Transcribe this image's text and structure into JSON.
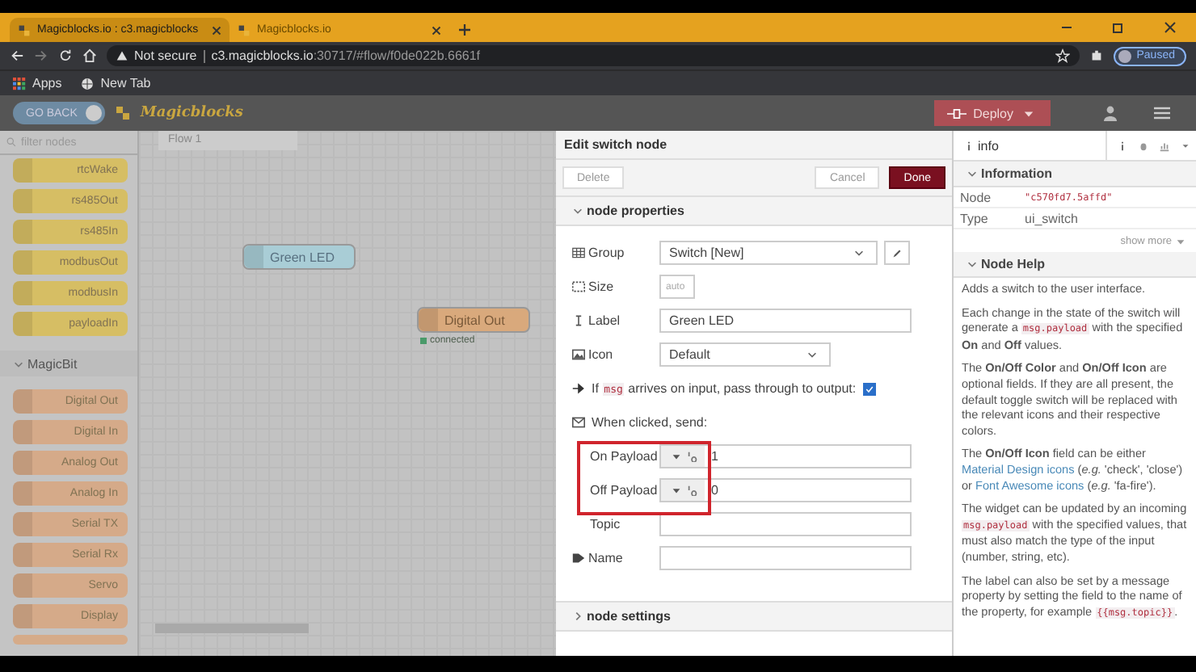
{
  "browser": {
    "tabs": [
      {
        "title": "Magicblocks.io : c3.magicblocks",
        "selected": true
      },
      {
        "title": "Magicblocks.io",
        "selected": false
      }
    ],
    "security": "Not secure",
    "url_host": "c3.magicblocks.io",
    "url_rest": ":30717/#flow/f0de022b.6661f",
    "profile": "Paused",
    "bookmarks": [
      "Apps",
      "New Tab"
    ]
  },
  "header": {
    "go_back": "GO BACK",
    "logo": "Magicblocks",
    "deploy": "Deploy"
  },
  "palette": {
    "placeholder": "filter nodes",
    "categories": [
      {
        "color": "#d9be5a",
        "nodes": [
          "rtcWake",
          "rs485Out",
          "rs485In",
          "modbusOut",
          "modbusIn",
          "payloadIn"
        ]
      },
      {
        "name": "MagicBit",
        "color": "#d7a883",
        "nodes": [
          "Digital Out",
          "Digital In",
          "Analog Out",
          "Analog In",
          "Serial TX",
          "Serial Rx",
          "Servo",
          "Display"
        ]
      }
    ]
  },
  "workspace": {
    "tab": "Flow 1",
    "nodes": [
      {
        "label": "Green LED",
        "color": "#a9cdd6"
      },
      {
        "label": "Digital Out",
        "color": "#d9a97c",
        "status": "connected"
      }
    ]
  },
  "tray": {
    "title": "Edit switch node",
    "buttons": {
      "delete": "Delete",
      "cancel": "Cancel",
      "done": "Done"
    },
    "sections": [
      {
        "title": "node properties",
        "expanded": true
      },
      {
        "title": "node settings",
        "expanded": false
      }
    ],
    "rows": [
      {
        "kind": "select",
        "label": "Group",
        "value": "Switch [New]"
      },
      {
        "kind": "size",
        "label": "Size",
        "value": "auto"
      },
      {
        "kind": "input",
        "label": "Label",
        "value": "Green LED"
      },
      {
        "kind": "select-short",
        "label": "Icon",
        "value": "Default"
      },
      {
        "kind": "checkbox",
        "before": "If",
        "code": "msg",
        "after": "arrives on input, pass through to output:",
        "checked": true
      },
      {
        "kind": "heading",
        "label": "When clicked, send:"
      },
      {
        "kind": "typed",
        "label": "On Payload",
        "value": "1"
      },
      {
        "kind": "typed",
        "label": "Off Payload",
        "value": "0"
      },
      {
        "kind": "input",
        "label": "Topic",
        "value": ""
      },
      {
        "kind": "input",
        "label": "Name",
        "value": ""
      }
    ]
  },
  "info": {
    "tab": "info",
    "sections": [
      "Information",
      "Node Help"
    ],
    "node_label": "Node",
    "node_value": "\"c570fd7.5affd\"",
    "type_label": "Type",
    "type_value": "ui_switch",
    "show_more": "show more",
    "help": [
      [
        {
          "kind": "text",
          "t": "Adds a switch to the user interface."
        }
      ],
      [
        {
          "kind": "text",
          "t": "Each change in the state of the switch will generate a "
        },
        {
          "kind": "code",
          "t": "msg.payload"
        },
        {
          "kind": "text",
          "t": " with the specified "
        },
        {
          "kind": "bold",
          "t": "On"
        },
        {
          "kind": "text",
          "t": " and "
        },
        {
          "kind": "bold",
          "t": "Off"
        },
        {
          "kind": "text",
          "t": " values."
        }
      ],
      [
        {
          "kind": "text",
          "t": "The "
        },
        {
          "kind": "bold",
          "t": "On/Off Color"
        },
        {
          "kind": "text",
          "t": " and "
        },
        {
          "kind": "bold",
          "t": "On/Off Icon"
        },
        {
          "kind": "text",
          "t": " are optional fields. If they are all present, the default toggle switch will be replaced with the relevant icons and their respective colors."
        }
      ],
      [
        {
          "kind": "text",
          "t": "The "
        },
        {
          "kind": "bold",
          "t": "On/Off Icon"
        },
        {
          "kind": "text",
          "t": " field can be either "
        },
        {
          "kind": "link",
          "t": "Material Design icons"
        },
        {
          "kind": "text",
          "t": " ("
        },
        {
          "kind": "italic",
          "t": "e.g."
        },
        {
          "kind": "text",
          "t": " 'check', 'close') or "
        },
        {
          "kind": "link",
          "t": "Font Awesome icons"
        },
        {
          "kind": "text",
          "t": " ("
        },
        {
          "kind": "italic",
          "t": "e.g."
        },
        {
          "kind": "text",
          "t": " 'fa-fire')."
        }
      ],
      [
        {
          "kind": "text",
          "t": "The widget can be updated by an incoming "
        },
        {
          "kind": "code",
          "t": "msg.payload"
        },
        {
          "kind": "text",
          "t": " with the specified values, that must also match the type of the input (number, string, etc)."
        }
      ],
      [
        {
          "kind": "text",
          "t": "The label can also be set by a message property by setting the field to the name of the property, for example "
        },
        {
          "kind": "code",
          "t": "{{msg.topic}}"
        },
        {
          "kind": "text",
          "t": "."
        }
      ]
    ]
  }
}
